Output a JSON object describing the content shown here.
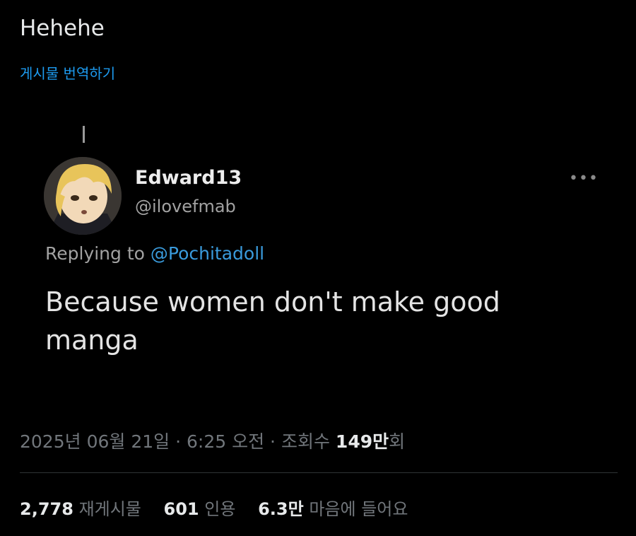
{
  "post": {
    "text": "Hehehe",
    "translate_label": "게시물 번역하기"
  },
  "embedded": {
    "display_name": "Edward13",
    "handle": "@ilovefmab",
    "replying_prefix": "Replying to ",
    "replying_to": "@Pochitadoll",
    "body": "Because women don't make good manga",
    "more_icon": "more-horizontal-icon"
  },
  "meta": {
    "date": "2025년 06월 21일",
    "separator": "·",
    "time": "6:25 오전",
    "views_label": "조회수",
    "views_number": "149만",
    "views_suffix": "회"
  },
  "stats": {
    "reposts_count": "2,778",
    "reposts_label": "재게시물",
    "quotes_count": "601",
    "quotes_label": "인용",
    "likes_count": "6.3만",
    "likes_label": "마음에 들어요"
  },
  "colors": {
    "background": "#000000",
    "text": "#e7e9ea",
    "muted": "#71767b",
    "link": "#1d9bf0",
    "divider": "#2f3336"
  }
}
